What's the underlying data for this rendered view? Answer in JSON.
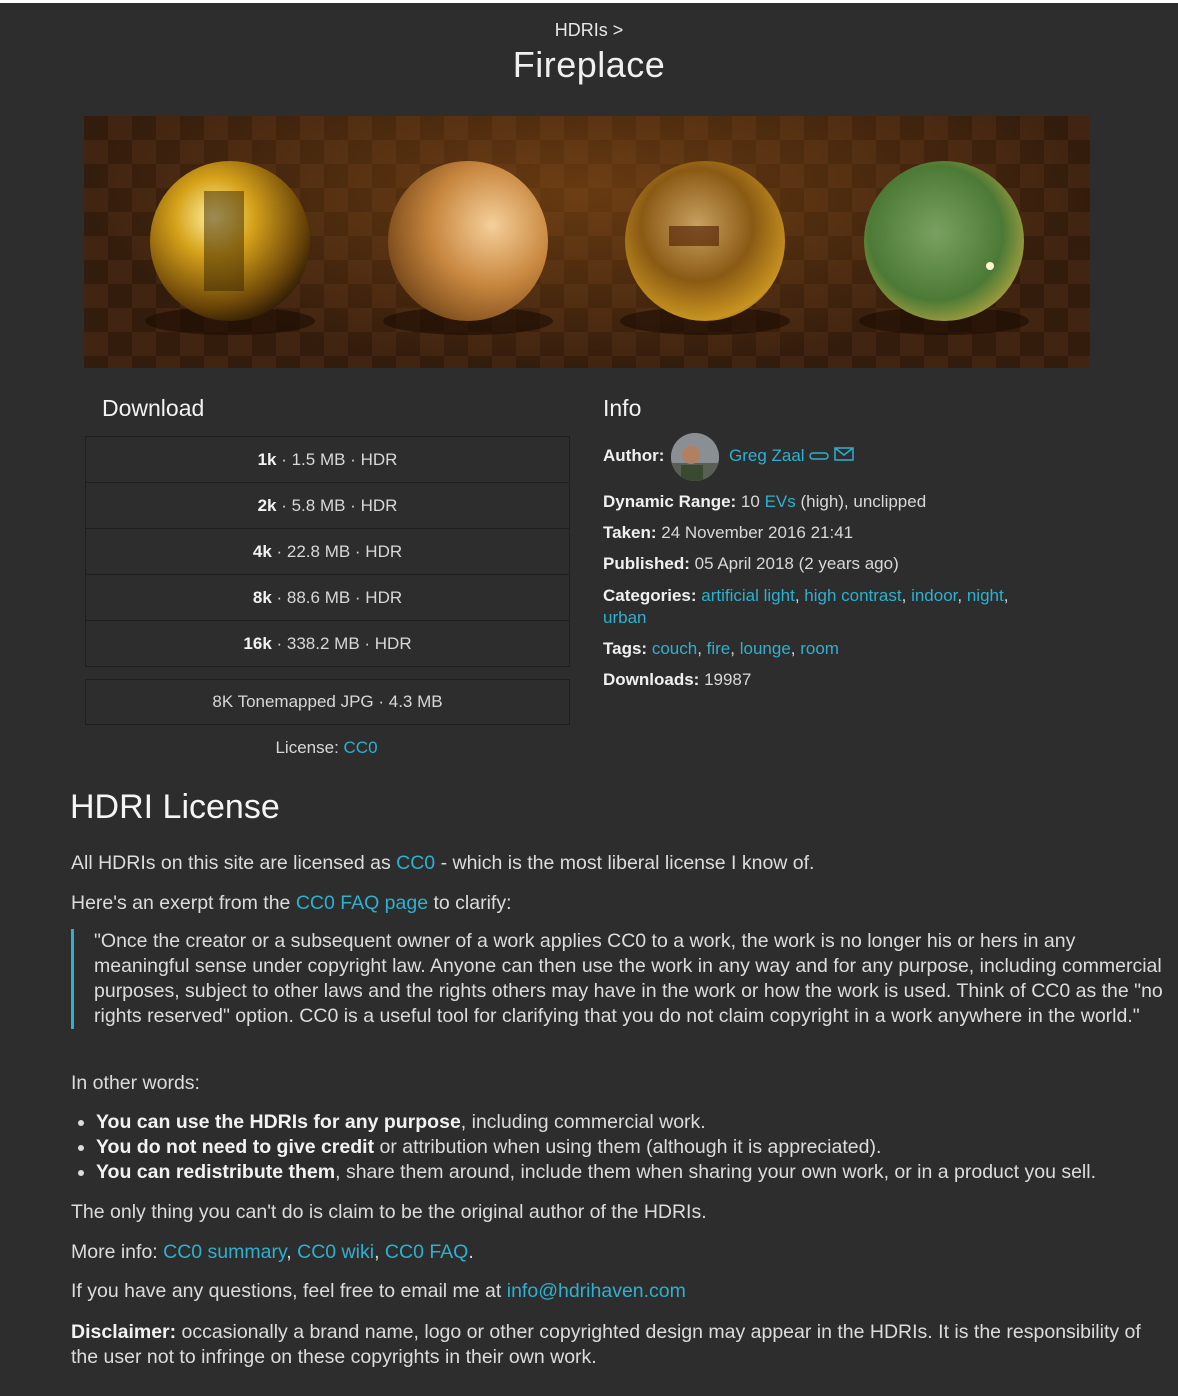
{
  "breadcrumb": "HDRIs >",
  "title": "Fireplace",
  "download": {
    "heading": "Download",
    "options": [
      {
        "res": "1k",
        "detail": " · 1.5 MB · HDR"
      },
      {
        "res": "2k",
        "detail": " · 5.8 MB · HDR"
      },
      {
        "res": "4k",
        "detail": " · 22.8 MB · HDR"
      },
      {
        "res": "8k",
        "detail": " · 88.6 MB · HDR"
      },
      {
        "res": "16k",
        "detail": " · 338.2 MB · HDR"
      }
    ],
    "jpg": "8K Tonemapped JPG · 4.3 MB",
    "license_label": "License: ",
    "license_link": "CC0"
  },
  "info": {
    "heading": "Info",
    "author_label": "Author:",
    "author_name": "Greg Zaal",
    "dynamic_range_label": "Dynamic Range:",
    "dynamic_range_pre": " 10 ",
    "dynamic_range_link": "EVs",
    "dynamic_range_post": " (high), unclipped",
    "taken_label": "Taken:",
    "taken_value": " 24 November 2016 21:41",
    "published_label": "Published:",
    "published_value": " 05 April 2018 (2 years ago)",
    "categories_label": "Categories:",
    "categories": [
      "artificial light",
      "high contrast",
      "indoor",
      "night",
      "urban"
    ],
    "tags_label": "Tags:",
    "tags": [
      "couch",
      "fire",
      "lounge",
      "room"
    ],
    "downloads_label": "Downloads:",
    "downloads_value": " 19987"
  },
  "license_section": {
    "heading": "HDRI License",
    "p1_pre": "All HDRIs on this site are licensed as ",
    "p1_link": "CC0",
    "p1_post": " - which is the most liberal license I know of.",
    "p2_pre": "Here's an exerpt from the ",
    "p2_link": "CC0 FAQ page",
    "p2_post": " to clarify:",
    "quote": "\"Once the creator or a subsequent owner of a work applies CC0 to a work, the work is no longer his or hers in any meaningful sense under copyright law. Anyone can then use the work in any way and for any purpose, including commercial purposes, subject to other laws and the rights others may have in the work or how the work is used. Think of CC0 as the \"no rights reserved\" option. CC0 is a useful tool for clarifying that you do not claim copyright in a work anywhere in the world.\"",
    "in_other_words": "In other words:",
    "bullets": [
      {
        "bold": "You can use the HDRIs for any purpose",
        "rest": ", including commercial work."
      },
      {
        "bold": "You do not need to give credit",
        "rest": " or attribution when using them (although it is appreciated)."
      },
      {
        "bold": "You can redistribute them",
        "rest": ", share them around, include them when sharing your own work, or in a product you sell."
      }
    ],
    "only_thing": "The only thing you can't do is claim to be the original author of the HDRIs.",
    "more_info_label": "More info: ",
    "more_info_links": [
      "CC0 summary",
      "CC0 wiki",
      "CC0 FAQ"
    ],
    "questions_pre": "If you have any questions, feel free to email me at ",
    "email": "info@hdrihaven.com",
    "disclaimer_label": "Disclaimer:",
    "disclaimer_text": " occasionally a brand name, logo or other copyrighted design may appear in the HDRIs. It is the responsibility of the user not to infringe on these copyrights in their own work."
  },
  "colors": {
    "background": "#2d2d2d",
    "link": "#2fb0cf",
    "quote_bar": "#2fb0cf"
  }
}
